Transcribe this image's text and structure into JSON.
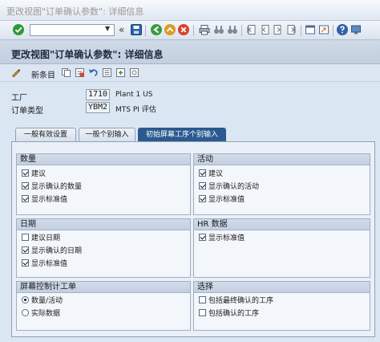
{
  "window": {
    "title": "更改视图\"订单确认参数\": 详细信息"
  },
  "toolbar": {
    "command_value": "",
    "back_symbol": "«"
  },
  "screen": {
    "title": "更改视图\"订单确认参数\": 详细信息"
  },
  "app_toolbar": {
    "new_entries_label": "新条目"
  },
  "header_fields": {
    "plant": {
      "label": "工厂",
      "value": "1710",
      "description": "Plant 1 US"
    },
    "order_type": {
      "label": "订单类型",
      "value": "YBM2",
      "description": "MTS PI 评估"
    }
  },
  "tabs": [
    {
      "label": "一般有效设置",
      "active": false
    },
    {
      "label": "一般个别输入",
      "active": false
    },
    {
      "label": "初始屏幕工序个别输入",
      "active": true
    }
  ],
  "groups": {
    "quantity": {
      "title": "数量",
      "options": [
        {
          "label": "建议",
          "checked": true
        },
        {
          "label": "显示确认的数量",
          "checked": true
        },
        {
          "label": "显示标准值",
          "checked": true
        }
      ]
    },
    "activities": {
      "title": "活动",
      "options": [
        {
          "label": "建议",
          "checked": true
        },
        {
          "label": "显示确认的活动",
          "checked": true
        },
        {
          "label": "显示标准值",
          "checked": true
        }
      ]
    },
    "dates": {
      "title": "日期",
      "options": [
        {
          "label": "建议日期",
          "checked": false
        },
        {
          "label": "显示确认的日期",
          "checked": true
        },
        {
          "label": "显示标准值",
          "checked": true
        }
      ]
    },
    "hr_data": {
      "title": "HR 数据",
      "options": [
        {
          "label": "显示标准值",
          "checked": true
        }
      ]
    },
    "screen_control": {
      "title": "屏幕控制计工单",
      "options": [
        {
          "label": "数量/活动",
          "selected": true
        },
        {
          "label": "实际数据",
          "selected": false
        }
      ]
    },
    "selection": {
      "title": "选择",
      "options": [
        {
          "label": "包括最终确认的工序",
          "checked": false
        },
        {
          "label": "包括确认的工序",
          "checked": false
        }
      ]
    }
  },
  "icons": {
    "enter": "check-circle-icon",
    "save": "save-icon",
    "back": "back-icon",
    "exit": "exit-icon",
    "cancel": "cancel-icon",
    "print": "print-icon",
    "find": "find-icon",
    "find_next": "find-next-icon",
    "first_page": "first-page-icon",
    "prev_page": "previous-page-icon",
    "next_page": "next-page-icon",
    "last_page": "last-page-icon",
    "new_session": "new-session-icon",
    "shortcut": "shortcut-icon",
    "help": "help-icon",
    "layout": "layout-icon",
    "edit_toggle": "glasses-pencil-icon",
    "copy": "copy-icon",
    "delete": "delete-icon",
    "undo": "undo-icon",
    "select_all": "select-all-icon",
    "select_block": "select-block-icon",
    "deselect_all": "deselect-all-icon"
  },
  "colors": {
    "active_tab": "#2a5a8f",
    "background": "#dbe6f3",
    "enter_green": "#2e9a3a",
    "save_blue": "#2c63a8"
  }
}
